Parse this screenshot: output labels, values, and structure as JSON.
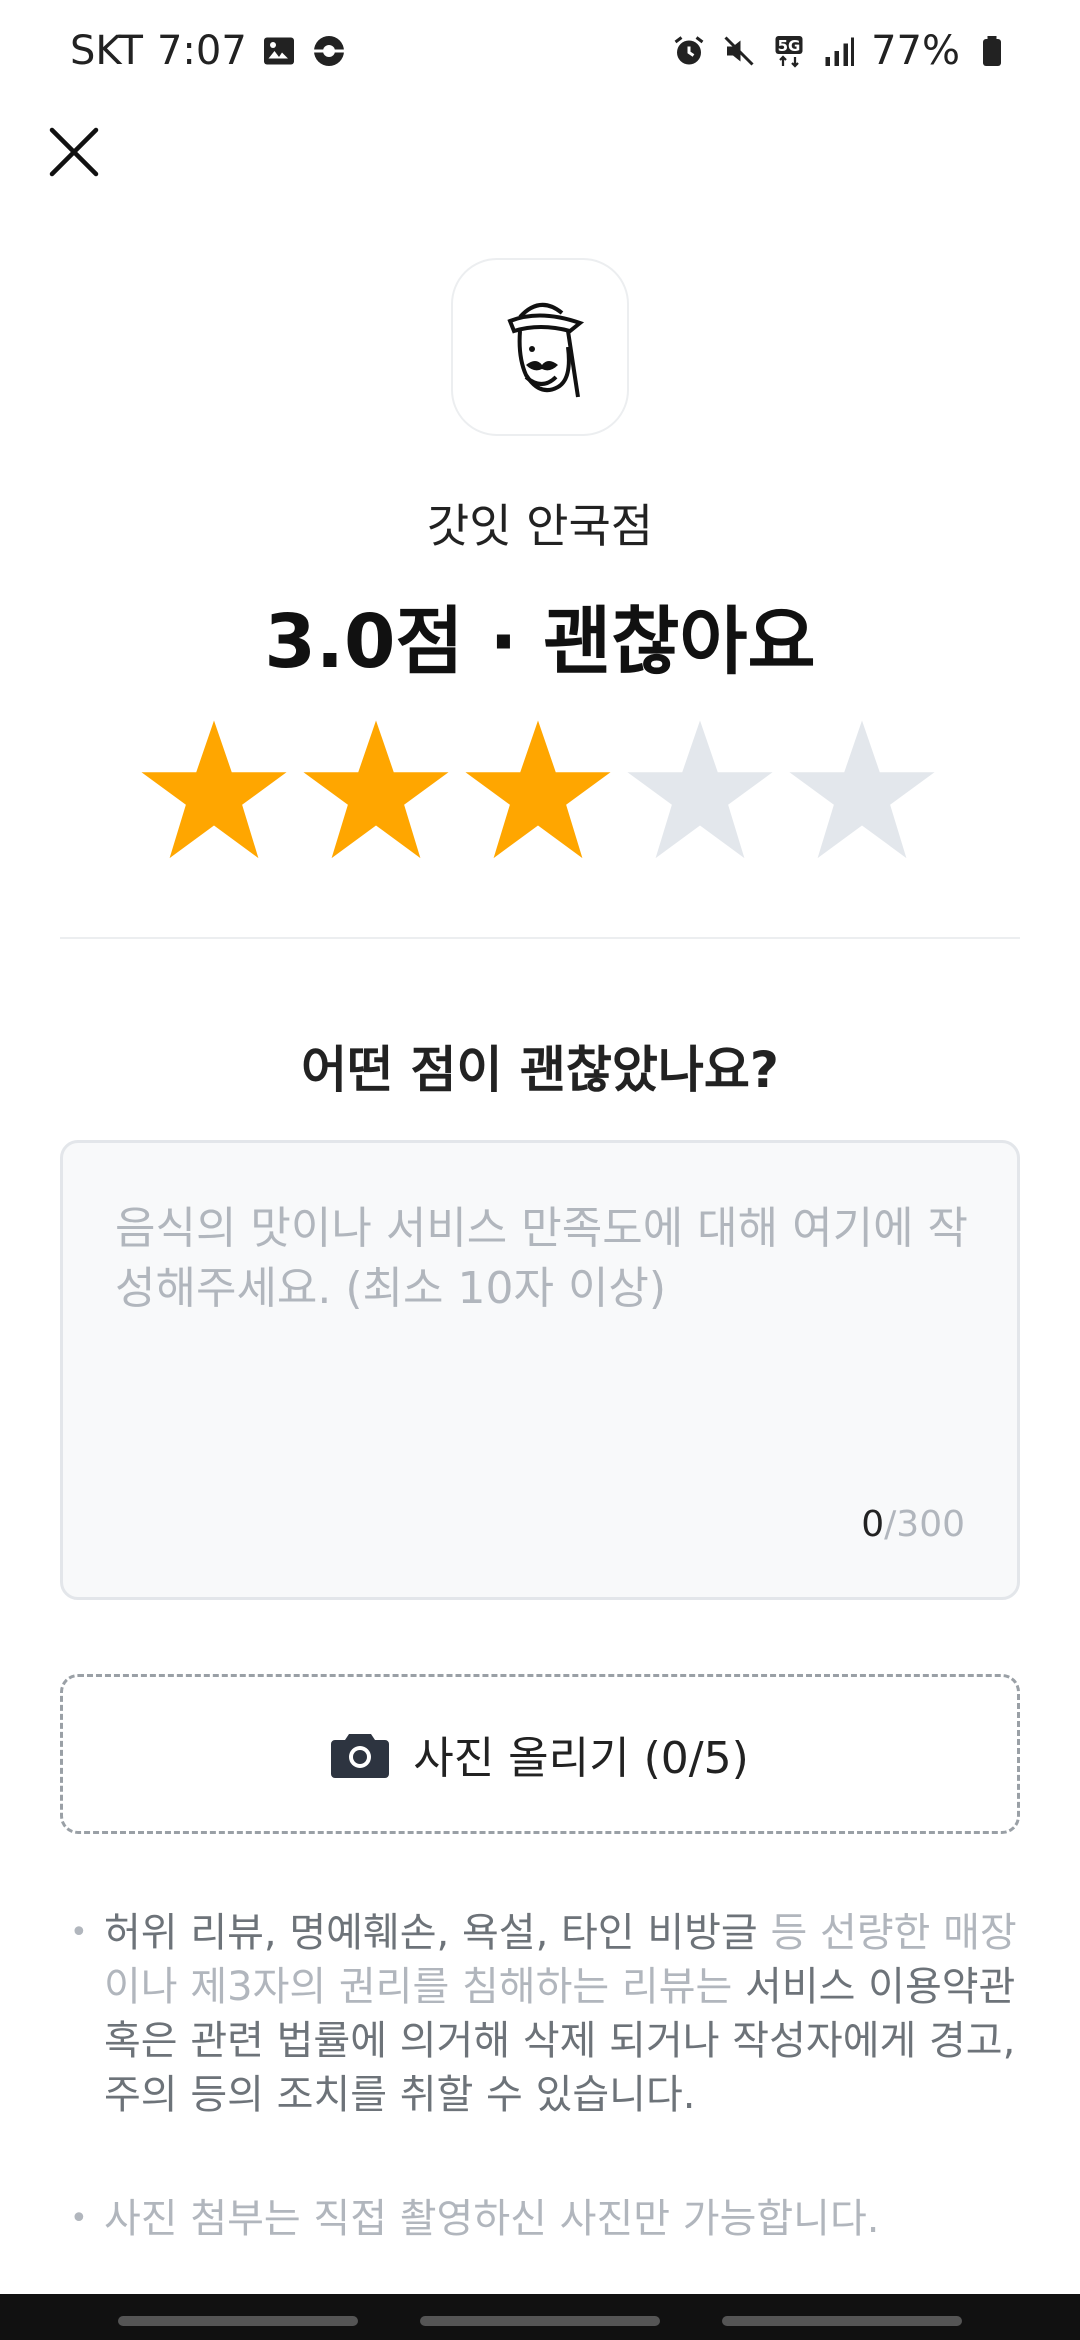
{
  "status_bar": {
    "carrier": "SKT",
    "time": "7:07",
    "battery": "77%",
    "icons_left": [
      "gallery-icon",
      "sync-icon"
    ],
    "icons_right": [
      "alarm-icon",
      "mute-icon",
      "5g-icon",
      "signal-icon",
      "battery-icon"
    ]
  },
  "header": {
    "close_icon": "close-icon"
  },
  "store": {
    "name": "갓잇 안국점",
    "logo_icon": "store-logo"
  },
  "rating": {
    "title": "3.0점 · 괜찮아요",
    "value": 3,
    "max": 5,
    "filled_color": "#FFA600",
    "empty_color": "#E3E7EC"
  },
  "review": {
    "question": "어떤 점이 괜찮았나요?",
    "placeholder": "음식의 맛이나 서비스 만족도에 대해 여기에 작성해주세요. (최소 10자 이상)",
    "value": "",
    "count_current": "0",
    "count_max": "/300"
  },
  "upload": {
    "label": "사진 올리기 (0/5)",
    "icon": "camera-icon"
  },
  "notices": {
    "first_part1": "허위 리뷰, 명예훼손, 욕설, 타인 비방글 ",
    "first_hl1": "등 선량한 매장이나 제3자의 권리를 침해하는 리뷰는 ",
    "first_part2": "서비스 이용약관 혹은 관련 법률에 의거해 삭제 되거나 작성자에게 경고, 주의 등의 조치를 취할 수 있습니다.",
    "second": "사진 첨부는 직접 촬영하신 사진만 가능합니다."
  },
  "colors": {
    "star_filled": "#FFA600",
    "star_empty": "#E3E7EC",
    "muted_text": "#B1B6BD"
  }
}
